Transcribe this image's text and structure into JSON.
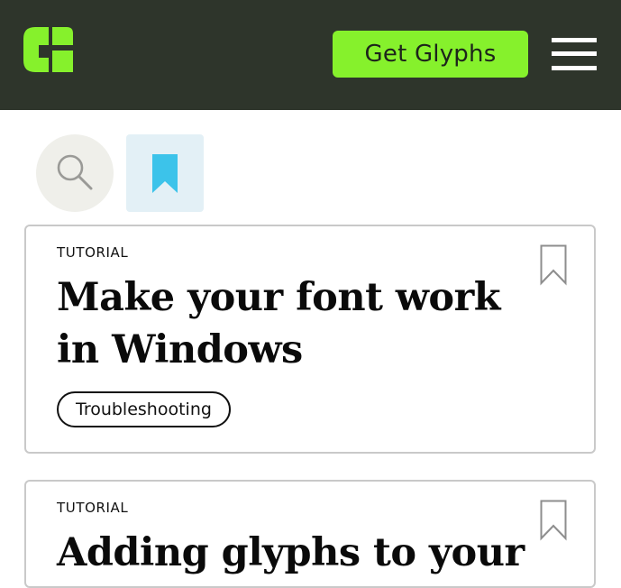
{
  "header": {
    "logo_icon": "glyphs-logo-icon",
    "cta_label": "Get Glyphs",
    "menu_icon": "hamburger-menu-icon",
    "accent_color": "#86f12c",
    "background_color": "#2e352b"
  },
  "toolbar": {
    "search_icon": "magnifier-icon",
    "bookmarks_icon": "bookmark-filled-icon",
    "bookmark_color": "#3cc3ea"
  },
  "cards": [
    {
      "category": "TUTORIAL",
      "title": "Make your font work in Windows",
      "topic": "Troubleshooting",
      "bookmark_icon": "bookmark-outline-icon"
    },
    {
      "category": "TUTORIAL",
      "title": "Adding glyphs to your",
      "bookmark_icon": "bookmark-outline-icon"
    }
  ]
}
